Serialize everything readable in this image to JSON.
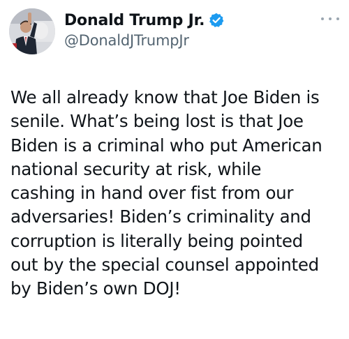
{
  "author": {
    "display_name": "Donald Trump Jr.",
    "handle": "@DonaldJTrumpJr",
    "verified": true,
    "avatar_icon": "profile-photo",
    "verified_color": "#1d9bf0"
  },
  "menu": {
    "icon": "more-options-icon"
  },
  "tweet": {
    "lines": [
      "We all already know that Joe Biden is",
      "senile. What’s being lost is that Joe",
      "Biden is a criminal who put American",
      "national security at risk, while",
      "cashing in hand over fist from our",
      "adversaries!  Biden’s criminality and",
      "corruption is literally being pointed",
      "out by the special counsel appointed",
      "by Biden’s own DOJ!"
    ]
  }
}
